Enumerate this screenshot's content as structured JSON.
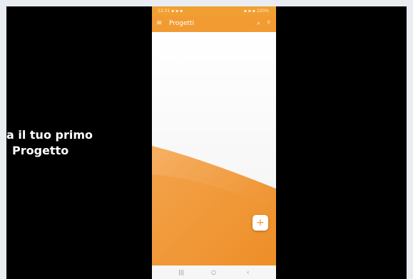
{
  "caption": {
    "line1": "a il tuo primo",
    "line2": "Progetto"
  },
  "status_bar": {
    "left_text": "12:31 ▪ ▪ ▪",
    "right_text": "▪ ▪ ▪ 100%"
  },
  "app_bar": {
    "title": "Progetti",
    "menu_icon": "menu-icon",
    "search_icon": "search-icon",
    "filter_icon": "filter-icon"
  },
  "fab": {
    "icon": "plus-icon",
    "glyph": "+"
  },
  "nav_bar": {
    "recent_glyph": "|||",
    "home_glyph": "○",
    "back_glyph": "‹"
  },
  "colors": {
    "accent": "#f29b32",
    "wave_light": "#f6b064",
    "wave_dark": "#ec8a20",
    "background": "#000000"
  }
}
